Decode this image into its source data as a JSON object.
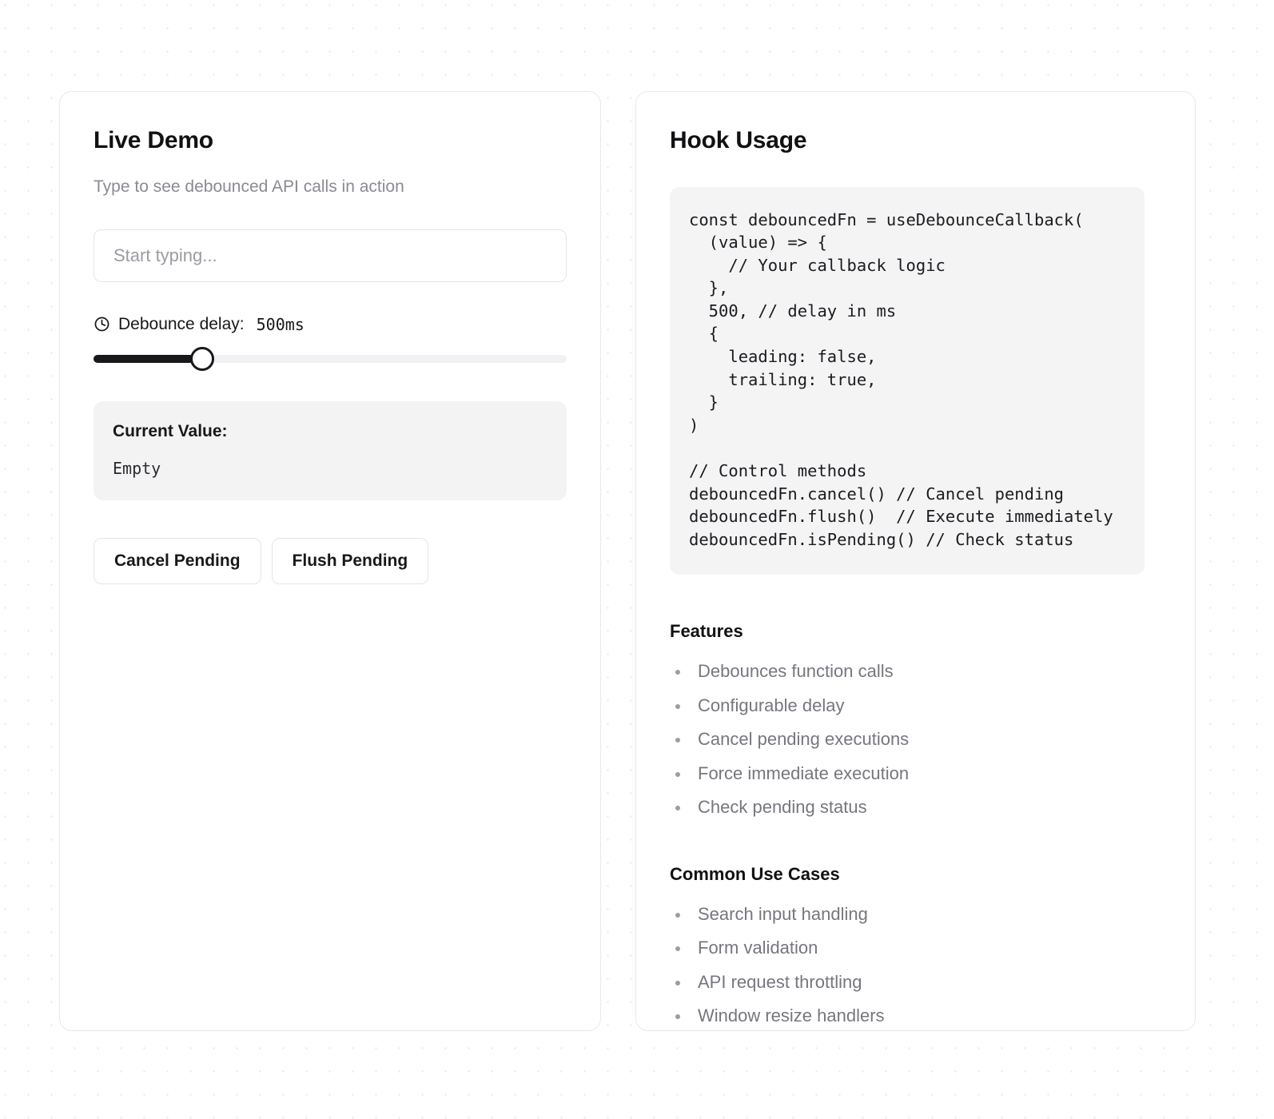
{
  "demo_panel": {
    "title": "Live Demo",
    "subtitle": "Type to see debounced API calls in action",
    "input": {
      "placeholder": "Start typing...",
      "value": ""
    },
    "slider": {
      "icon": "clock-icon",
      "label": "Debounce delay:",
      "value_text": "500ms",
      "value": 500,
      "min": 0,
      "max": 2000,
      "fill_percent": 23
    },
    "current_value": {
      "title": "Current Value:",
      "value": "Empty"
    },
    "buttons": [
      {
        "label": "Cancel Pending",
        "name": "cancel-pending-button"
      },
      {
        "label": "Flush Pending",
        "name": "flush-pending-button"
      }
    ]
  },
  "usage_panel": {
    "title": "Hook Usage",
    "code": "const debouncedFn = useDebounceCallback(\n  (value) => {\n    // Your callback logic\n  },\n  500, // delay in ms\n  {\n    leading: false,\n    trailing: true,\n  }\n)\n\n// Control methods\ndebouncedFn.cancel() // Cancel pending\ndebouncedFn.flush()  // Execute immediately\ndebouncedFn.isPending() // Check status",
    "features": {
      "heading": "Features",
      "items": [
        "Debounces function calls",
        "Configurable delay",
        "Cancel pending executions",
        "Force immediate execution",
        "Check pending status"
      ]
    },
    "use_cases": {
      "heading": "Common Use Cases",
      "items": [
        "Search input handling",
        "Form validation",
        "API request throttling",
        "Window resize handlers"
      ]
    }
  },
  "colors": {
    "accent": "#18181b",
    "muted_text": "#76767f",
    "panel_border": "#e9e9ec",
    "code_bg": "#f4f4f5",
    "value_bg": "#f3f3f4",
    "dot_grid": "#e7e7ea"
  }
}
